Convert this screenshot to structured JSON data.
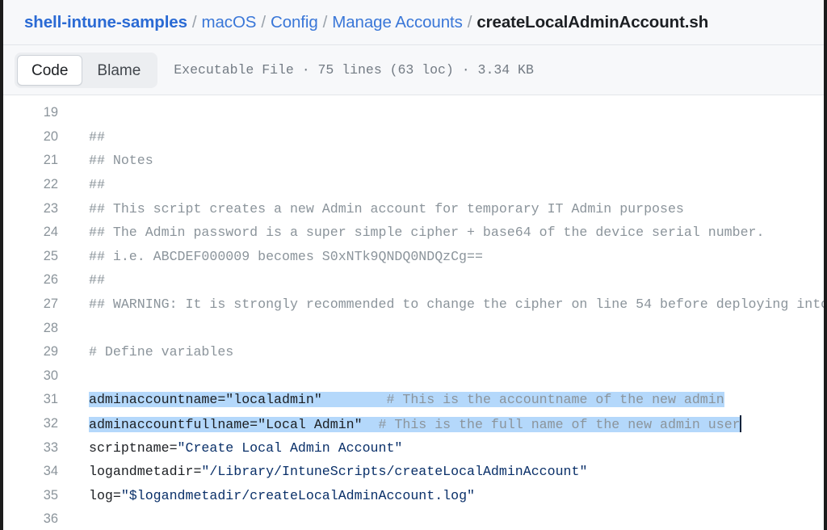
{
  "breadcrumb": {
    "separator": "/",
    "items": [
      {
        "label": "shell-intune-samples",
        "kind": "root-link"
      },
      {
        "label": "macOS",
        "kind": "link"
      },
      {
        "label": "Config",
        "kind": "link"
      },
      {
        "label": "Manage Accounts",
        "kind": "link"
      },
      {
        "label": "createLocalAdminAccount.sh",
        "kind": "current"
      }
    ]
  },
  "toolbar": {
    "tabs": [
      {
        "label": "Code",
        "active": true
      },
      {
        "label": "Blame",
        "active": false
      }
    ],
    "file_meta": "Executable File · 75 lines (63 loc) · 3.34 KB"
  },
  "colors": {
    "link": "#3a77d8",
    "selection_highlight": "#b4d8fb",
    "comment": "#8b949b",
    "string": "#0a3069",
    "toolbar_background": "#f7f8fa",
    "border": "#e2e5e9",
    "caret": "#11243d"
  },
  "code": {
    "first_line_number": 19,
    "lines": [
      {
        "n": "19",
        "segments": []
      },
      {
        "n": "20",
        "segments": [
          {
            "text": "##",
            "type": "comment"
          }
        ]
      },
      {
        "n": "21",
        "segments": [
          {
            "text": "## Notes",
            "type": "comment"
          }
        ]
      },
      {
        "n": "22",
        "segments": [
          {
            "text": "##",
            "type": "comment"
          }
        ]
      },
      {
        "n": "23",
        "segments": [
          {
            "text": "## This script creates a new Admin account for temporary IT Admin purposes",
            "type": "comment"
          }
        ]
      },
      {
        "n": "24",
        "segments": [
          {
            "text": "## The Admin password is a super simple cipher + base64 of the device serial number.",
            "type": "comment"
          }
        ]
      },
      {
        "n": "25",
        "segments": [
          {
            "text": "## i.e. ABCDEF000009 becomes S0xNTk9QNDQ0NDQzCg==",
            "type": "comment"
          }
        ]
      },
      {
        "n": "26",
        "segments": [
          {
            "text": "##",
            "type": "comment"
          }
        ]
      },
      {
        "n": "27",
        "segments": [
          {
            "text": "## WARNING: It is strongly recommended to change the cipher on line 54 before deploying into p",
            "type": "comment",
            "clipped": true
          }
        ]
      },
      {
        "n": "28",
        "segments": []
      },
      {
        "n": "29",
        "segments": [
          {
            "text": "# Define variables",
            "type": "comment"
          }
        ]
      },
      {
        "n": "30",
        "segments": []
      },
      {
        "n": "31",
        "selected": true,
        "segments": [
          {
            "text": "adminaccountname=\"localadmin\"",
            "type": "plain"
          },
          {
            "text": "        ",
            "type": "plain"
          },
          {
            "text": "# This is the accountname of the new admin",
            "type": "comment"
          }
        ]
      },
      {
        "n": "32",
        "selected": true,
        "caret": true,
        "segments": [
          {
            "text": "adminaccountfullname=\"Local Admin\"",
            "type": "plain"
          },
          {
            "text": "  ",
            "type": "plain"
          },
          {
            "text": "# This is the full name of the new admin user",
            "type": "comment"
          }
        ]
      },
      {
        "n": "33",
        "segments": [
          {
            "text": "scriptname=",
            "type": "plain"
          },
          {
            "text": "\"Create Local Admin Account\"",
            "type": "string"
          }
        ]
      },
      {
        "n": "34",
        "segments": [
          {
            "text": "logandmetadir=",
            "type": "plain"
          },
          {
            "text": "\"/Library/IntuneScripts/createLocalAdminAccount\"",
            "type": "string"
          }
        ]
      },
      {
        "n": "35",
        "segments": [
          {
            "text": "log=",
            "type": "plain"
          },
          {
            "text": "\"$logandmetadir/createLocalAdminAccount.log\"",
            "type": "string"
          }
        ]
      },
      {
        "n": "36",
        "segments": []
      }
    ]
  }
}
